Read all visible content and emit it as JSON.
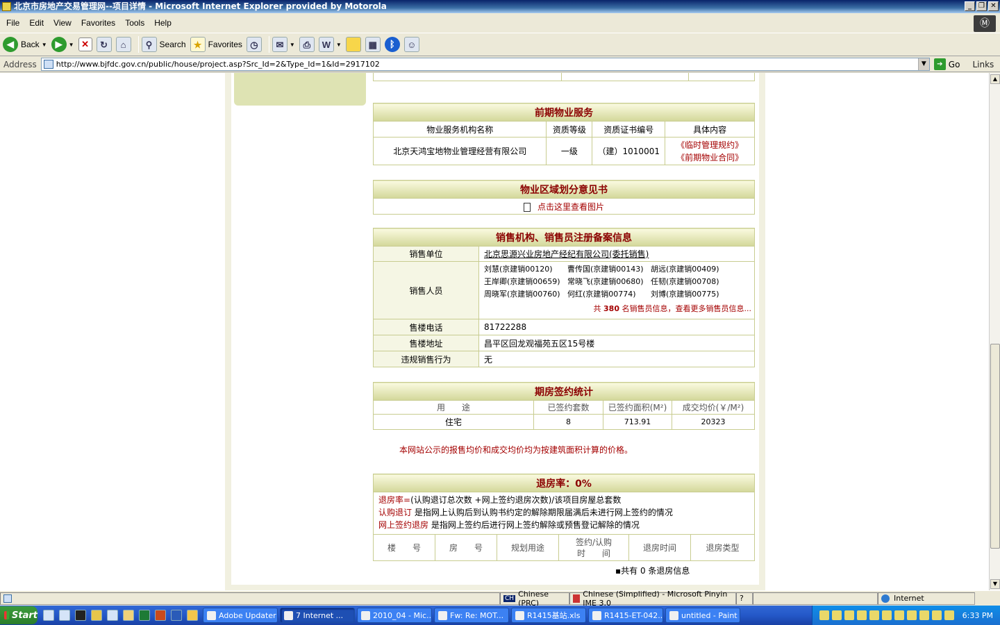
{
  "window": {
    "title": "北京市房地产交易管理网--项目详情 - Microsoft Internet Explorer provided by Motorola"
  },
  "menu": [
    "File",
    "Edit",
    "View",
    "Favorites",
    "Tools",
    "Help"
  ],
  "toolbar": {
    "back": "Back",
    "search": "Search",
    "favorites": "Favorites"
  },
  "address": {
    "label": "Address",
    "url": "http://www.bjfdc.gov.cn/public/house/project.asp?Src_Id=2&Type_Id=1&Id=2917102",
    "go": "Go",
    "links": "Links"
  },
  "property_service": {
    "title": "前期物业服务",
    "headers": [
      "物业服务机构名称",
      "资质等级",
      "资质证书编号",
      "具体内容"
    ],
    "row": {
      "company": "北京天鸿宝地物业管理经营有限公司",
      "grade": "一级",
      "cert": "（建）1010001",
      "link1": "《临时管理规约》",
      "link2": "《前期物业合同》"
    }
  },
  "division": {
    "title": "物业区域划分意见书",
    "link": "点击这里查看图片"
  },
  "sales": {
    "title": "销售机构、销售员注册备案信息",
    "unit_label": "销售单位",
    "unit": "北京思源兴业房地产经纪有限公司(委托销售)",
    "staff_label": "销售人员",
    "staff": [
      [
        "刘慧(京建销00120)",
        "曹传国(京建销00143)",
        "胡远(京建销00409)"
      ],
      [
        "王岸卿(京建销00659)",
        "常晓飞(京建销00680)",
        "任韧(京建销00708)"
      ],
      [
        "周晓军(京建销00760)",
        "何红(京建销00774)",
        "刘博(京建销00775)"
      ]
    ],
    "more_prefix": "共",
    "more_count": "380",
    "more_suffix": "名销售员信息，查看更多销售员信息...",
    "phone_label": "售楼电话",
    "phone": "81722288",
    "addr_label": "售楼地址",
    "addr": "昌平区回龙观福苑五区15号楼",
    "violation_label": "违规销售行为",
    "violation": "无"
  },
  "contract_stats": {
    "title": "期房签约统计",
    "headers": [
      "用　　途",
      "已签约套数",
      "已签约面积(M²)",
      "成交均价(￥/M²)"
    ],
    "row": [
      "住宅",
      "8",
      "713.91",
      "20323"
    ]
  },
  "notice": "本网站公示的报售均价和成交均价均为按建筑面积计算的价格。",
  "refund": {
    "title": "退房率：0%",
    "line1_key": "退房率=",
    "line1": "(认购退订总次数 +网上签约退房次数)/该项目房屋总套数",
    "line2_key": "认购退订",
    "line2": "是指网上认购后到认购书约定的解除期限届满后未进行网上签约的情况",
    "line3_key": "网上签约退房",
    "line3": "是指网上签约后进行网上签约解除或预售登记解除的情况",
    "headers": [
      "楼　　号",
      "房　　号",
      "规划用途",
      "签约/认购\n时　　间",
      "退房时间",
      "退房类型"
    ],
    "total": "▪共有 0 条退房信息"
  },
  "status": {
    "lang": "Chinese (PRC)",
    "ime": "Chinese (Simplified) - Microsoft Pinyin IME 3.0",
    "zone": "Internet"
  },
  "taskbar": {
    "start": "Start",
    "items": [
      "Adobe Updater",
      "7 Internet ...",
      "2010_04 - Mic...",
      "Fw: Re: MOT...",
      "R1415基站.xls",
      "R1415-ET-042...",
      "untitled - Paint"
    ],
    "time": "6:33 PM"
  }
}
